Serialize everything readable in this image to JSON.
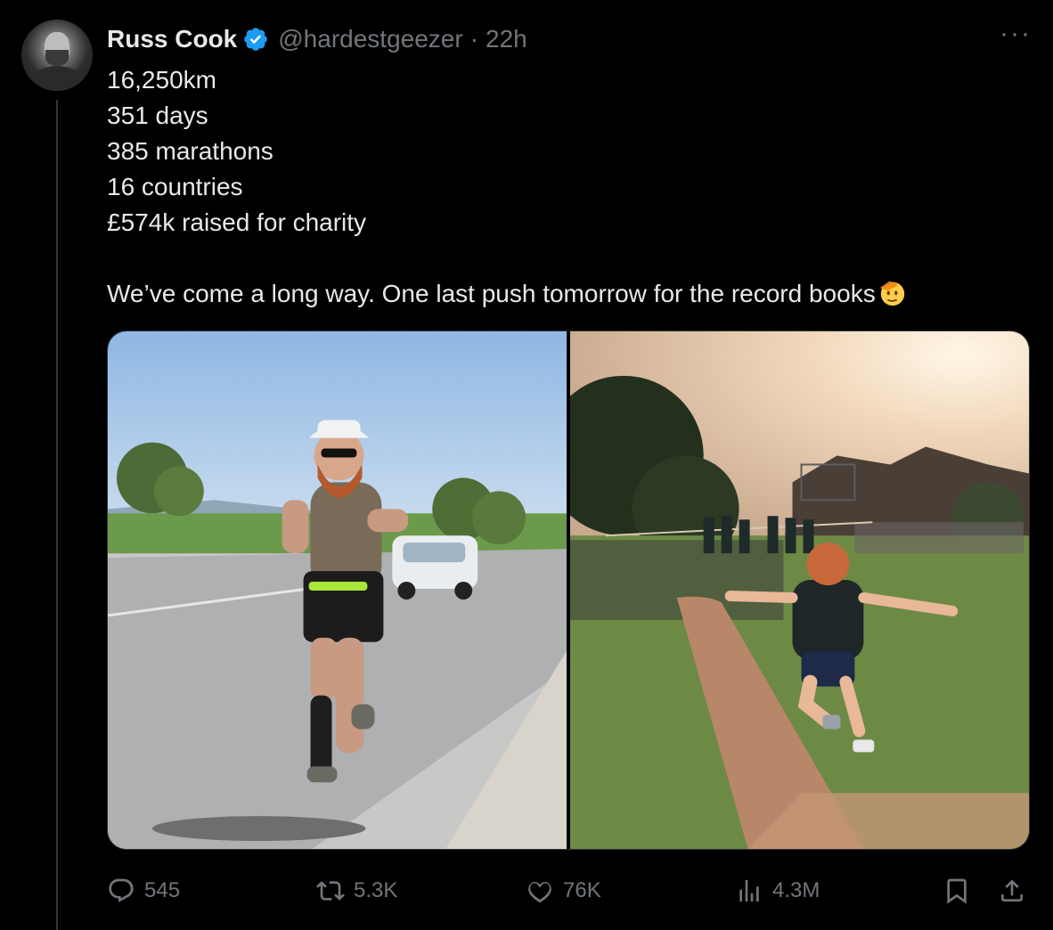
{
  "author": {
    "name": "Russ Cook",
    "handle": "@hardestgeezer",
    "separator": "·",
    "time": "22h",
    "verified_color": "#1d9bf0"
  },
  "more_label": "···",
  "tweet": {
    "lines": [
      "16,250km",
      "351 days",
      "385 marathons",
      "16 countries",
      "£574k raised for charity"
    ],
    "closing": "We’ve come a long way. One last push tomorrow for the record books"
  },
  "media": [
    {
      "name": "running-on-road-photo"
    },
    {
      "name": "childhood-long-jump-photo"
    }
  ],
  "stats": {
    "replies": "545",
    "reposts": "5.3K",
    "likes": "76K",
    "views": "4.3M"
  },
  "icons": {
    "reply": "speech-bubble-icon",
    "repost": "repost-arrows-icon",
    "like": "heart-icon",
    "views": "bar-chart-icon",
    "bookmark": "bookmark-icon",
    "share": "share-icon",
    "verified": "verified-badge-icon",
    "emoji": "saluting-face-emoji"
  },
  "colors": {
    "background": "#000000",
    "text": "#e7e9ea",
    "muted": "#71767b",
    "border": "#2f3336"
  }
}
